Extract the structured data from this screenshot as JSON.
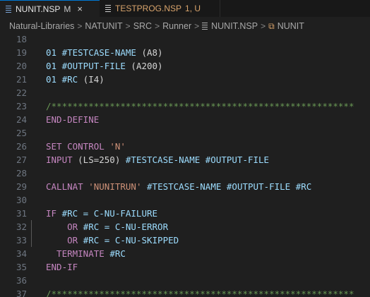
{
  "tabs": [
    {
      "label": "NUNIT.NSP",
      "status": "M",
      "close": "×",
      "active": true
    },
    {
      "label": "TESTPROG.NSP",
      "status": "1, U",
      "active": false
    }
  ],
  "breadcrumb": {
    "items": [
      "Natural-Libraries",
      "NATUNIT",
      "SRC",
      "Runner",
      "NUNIT.NSP",
      "NUNIT"
    ],
    "separator": ">"
  },
  "editor": {
    "lines": [
      {
        "num": "18",
        "tokens": []
      },
      {
        "num": "19",
        "tokens": [
          {
            "t": "01 #TESTCASE-NAME ",
            "c": "var"
          },
          {
            "t": "(A8)",
            "c": "pl"
          }
        ]
      },
      {
        "num": "20",
        "tokens": [
          {
            "t": "01 #OUTPUT-FILE ",
            "c": "var"
          },
          {
            "t": "(A200)",
            "c": "pl"
          }
        ]
      },
      {
        "num": "21",
        "tokens": [
          {
            "t": "01 #RC ",
            "c": "var"
          },
          {
            "t": "(I4)",
            "c": "pl"
          }
        ]
      },
      {
        "num": "22",
        "tokens": []
      },
      {
        "num": "23",
        "tokens": [
          {
            "t": "/*********************************************************",
            "c": "com"
          }
        ]
      },
      {
        "num": "24",
        "tokens": [
          {
            "t": "END-DEFINE",
            "c": "kw"
          }
        ]
      },
      {
        "num": "25",
        "tokens": []
      },
      {
        "num": "26",
        "tokens": [
          {
            "t": "SET CONTROL ",
            "c": "kw"
          },
          {
            "t": "'N'",
            "c": "str"
          }
        ]
      },
      {
        "num": "27",
        "tokens": [
          {
            "t": "INPUT ",
            "c": "kw"
          },
          {
            "t": "(LS=250) ",
            "c": "pl"
          },
          {
            "t": "#TESTCASE-NAME #OUTPUT-FILE",
            "c": "var"
          }
        ]
      },
      {
        "num": "28",
        "tokens": []
      },
      {
        "num": "29",
        "tokens": [
          {
            "t": "CALLNAT ",
            "c": "kw"
          },
          {
            "t": "'NUNITRUN' ",
            "c": "str"
          },
          {
            "t": "#TESTCASE-NAME #OUTPUT-FILE #RC",
            "c": "var"
          }
        ]
      },
      {
        "num": "30",
        "tokens": []
      },
      {
        "num": "31",
        "tokens": [
          {
            "t": "IF ",
            "c": "kw"
          },
          {
            "t": "#RC = C-NU-FAILURE",
            "c": "var"
          }
        ]
      },
      {
        "num": "32",
        "guide": true,
        "tokens": [
          {
            "t": "    OR ",
            "c": "kw"
          },
          {
            "t": "#RC = C-NU-ERROR",
            "c": "var"
          }
        ]
      },
      {
        "num": "33",
        "guide": true,
        "tokens": [
          {
            "t": "    OR ",
            "c": "kw"
          },
          {
            "t": "#RC = C-NU-SKIPPED",
            "c": "var"
          }
        ]
      },
      {
        "num": "34",
        "tokens": [
          {
            "t": "  TERMINATE ",
            "c": "kw"
          },
          {
            "t": "#RC",
            "c": "var"
          }
        ]
      },
      {
        "num": "35",
        "tokens": [
          {
            "t": "END-IF",
            "c": "kw"
          }
        ]
      },
      {
        "num": "36",
        "tokens": []
      },
      {
        "num": "37",
        "tokens": [
          {
            "t": "/*********************************************************",
            "c": "com"
          }
        ]
      }
    ]
  }
}
